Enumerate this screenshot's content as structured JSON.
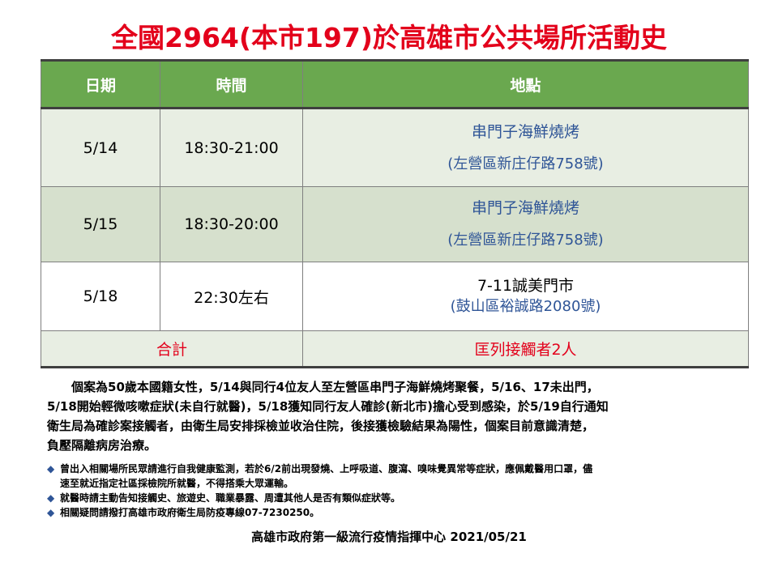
{
  "title": "全國2964(本市197)於高雄市公共場所活動史",
  "table": {
    "headers": {
      "date": "日期",
      "time": "時間",
      "place": "地點"
    },
    "rows": [
      {
        "date": "5/14",
        "time": "18:30-21:00",
        "place": "串門子海鮮燒烤",
        "address": "(左營區新庄仔路758號)"
      },
      {
        "date": "5/15",
        "time": "18:30-20:00",
        "place": "串門子海鮮燒烤",
        "address": "(左營區新庄仔路758號)"
      },
      {
        "date": "5/18",
        "time": "22:30左右",
        "place": "7-11誠美門市",
        "address": "(鼓山區裕誠路2080號)"
      }
    ],
    "total": {
      "label": "合計",
      "value": "匡列接觸者2人"
    }
  },
  "description": [
    "　　個案為50歲本國籍女性，5/14與同行4位友人至左營區串門子海鮮燒烤聚餐，5/16、17未出門，",
    "5/18開始輕微咳嗽症狀(未自行就醫)，5/18獲知同行友人確診(新北市)擔心受到感染，於5/19自行通知",
    "衛生局為確診案接觸者，由衛生局安排採檢並收治住院，後接獲檢驗結果為陽性，個案目前意識清楚，",
    "負壓隔離病房治療。"
  ],
  "notes": [
    {
      "bullet": "◆",
      "lines": [
        "曾出入相關場所民眾請進行自我健康監測，若於6/2前出現發燒、上呼吸道、腹瀉、嗅味覺異常等症狀，應佩戴醫用口罩，儘",
        "速至就近指定社區採檢院所就醫，不得搭乘大眾運輸。"
      ]
    },
    {
      "bullet": "◆",
      "lines": [
        "就醫時請主動告知接觸史、旅遊史、職業暴露、周遭其他人是否有類似症狀等。"
      ]
    },
    {
      "bullet": "◆",
      "lines": [
        "相關疑問請撥打高雄市政府衛生局防疫專線07-7230250。"
      ]
    }
  ],
  "footer": "高雄市政府第一級流行疫情指揮中心 2021/05/21",
  "colors": {
    "title": "#e3001b",
    "header_bg": "#6aa84f",
    "address": "#2f5597",
    "bullet": "#2f5597"
  }
}
